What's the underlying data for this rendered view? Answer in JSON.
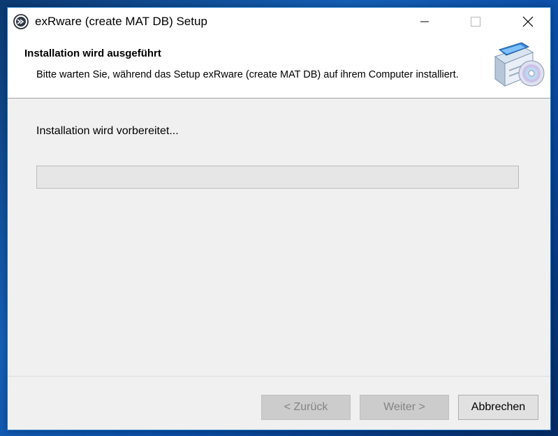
{
  "window": {
    "title": "exRware (create MAT DB) Setup"
  },
  "header": {
    "title": "Installation wird ausgeführt",
    "subtitle": "Bitte warten Sie, während das Setup exRware (create MAT DB) auf ihrem Computer installiert."
  },
  "main": {
    "status": "Installation wird vorbereitet...",
    "progress_percent": 0
  },
  "buttons": {
    "back_label": "< Zurück",
    "next_label": "Weiter >",
    "cancel_label": "Abbrechen"
  },
  "icons": {
    "app": "exrware-logo-icon",
    "header": "computer-cd-install-icon",
    "minimize": "minimize-icon",
    "maximize": "maximize-icon",
    "close": "close-icon"
  },
  "colors": {
    "progress_fill": "#06b025",
    "window_border": "#1979ca"
  }
}
